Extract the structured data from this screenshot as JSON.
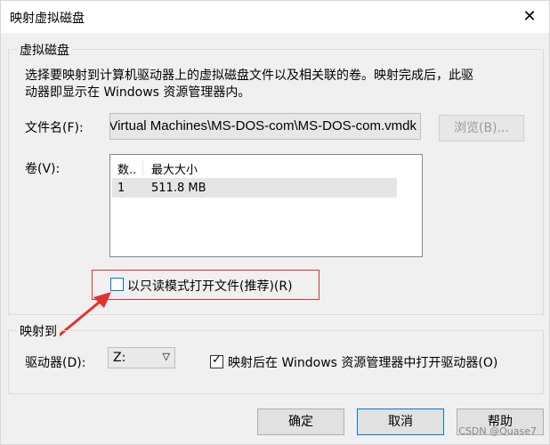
{
  "window": {
    "title": "映射虚拟磁盘",
    "close_label": "✕"
  },
  "virtual_disk": {
    "legend": "虚拟磁盘",
    "description_line1": "选择要映射到计算机驱动器上的虚拟磁盘文件以及相关联的卷。映射完成后，此驱",
    "description_line2": "动器即显示在 Windows 资源管理器内。",
    "filename_label": "文件名(F):",
    "filename_value": "s\\Virtual Machines\\MS-DOS-com\\MS-DOS-com.vmdk",
    "browse_button": "浏览(B)...",
    "volume_label": "卷(V):",
    "volume_table": {
      "headers": [
        "数..",
        "最大大小"
      ],
      "rows": [
        {
          "num": "1",
          "size": "511.8 MB"
        }
      ]
    },
    "readonly_checkbox": {
      "label": "以只读模式打开文件(推荐)(R)",
      "checked": false
    }
  },
  "map_to": {
    "legend": "映射到",
    "drive_label": "驱动器(D):",
    "drive_value": "Z:",
    "open_checkbox": {
      "label": "映射后在 Windows 资源管理器中打开驱动器(O)",
      "checked": true
    }
  },
  "buttons": {
    "ok": "确定",
    "cancel": "取消",
    "help": "帮助"
  },
  "watermark": "CSDN @Quase7",
  "colors": {
    "annotation_red": "#e03232",
    "focus_blue": "#0078d7"
  }
}
